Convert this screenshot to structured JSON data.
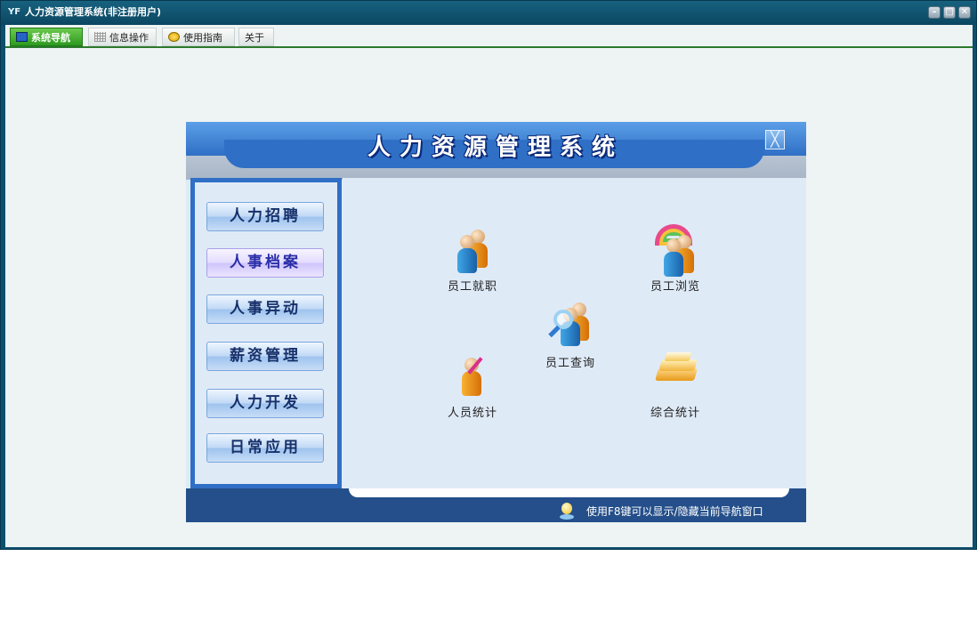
{
  "window": {
    "title": "人力资源管理系统(非注册用户)",
    "app_icon": "yf-logo-icon",
    "controls": [
      "minimize-icon",
      "maximize-icon",
      "close-icon"
    ]
  },
  "menubar": {
    "items": [
      {
        "label": "系统导航",
        "icon": "monitor-icon",
        "active": true
      },
      {
        "label": "信息操作",
        "icon": "grid-icon",
        "active": false
      },
      {
        "label": "使用指南",
        "icon": "smiley-icon",
        "active": false
      },
      {
        "label": "关于",
        "icon": "",
        "active": false
      }
    ]
  },
  "panel": {
    "title": "人力资源管理系统",
    "close_icon": "close-box-icon",
    "side_menu": [
      {
        "label": "人力招聘"
      },
      {
        "label": "人事档案",
        "highlighted": true
      },
      {
        "label": "人事异动"
      },
      {
        "label": "薪资管理"
      },
      {
        "label": "人力开发"
      },
      {
        "label": "日常应用"
      }
    ],
    "functions": [
      {
        "label": "员工就职",
        "icon": "staff-onboard-icon"
      },
      {
        "label": "员工浏览",
        "icon": "staff-browse-rainbow-icon"
      },
      {
        "label": "员工查询",
        "icon": "staff-search-magnifier-icon"
      },
      {
        "label": "人员统计",
        "icon": "personnel-stats-icon"
      },
      {
        "label": "综合统计",
        "icon": "books-stats-icon"
      }
    ],
    "hint": "使用F8键可以显示/隐藏当前导航窗口",
    "hint_icon": "lightbulb-icon"
  },
  "colors": {
    "title_bar": "#0b4661",
    "active_tab": "#2c9a1f",
    "panel_blue": "#2f6fc6",
    "panel_bg": "#dfeaf7",
    "footer": "#244f8a"
  }
}
